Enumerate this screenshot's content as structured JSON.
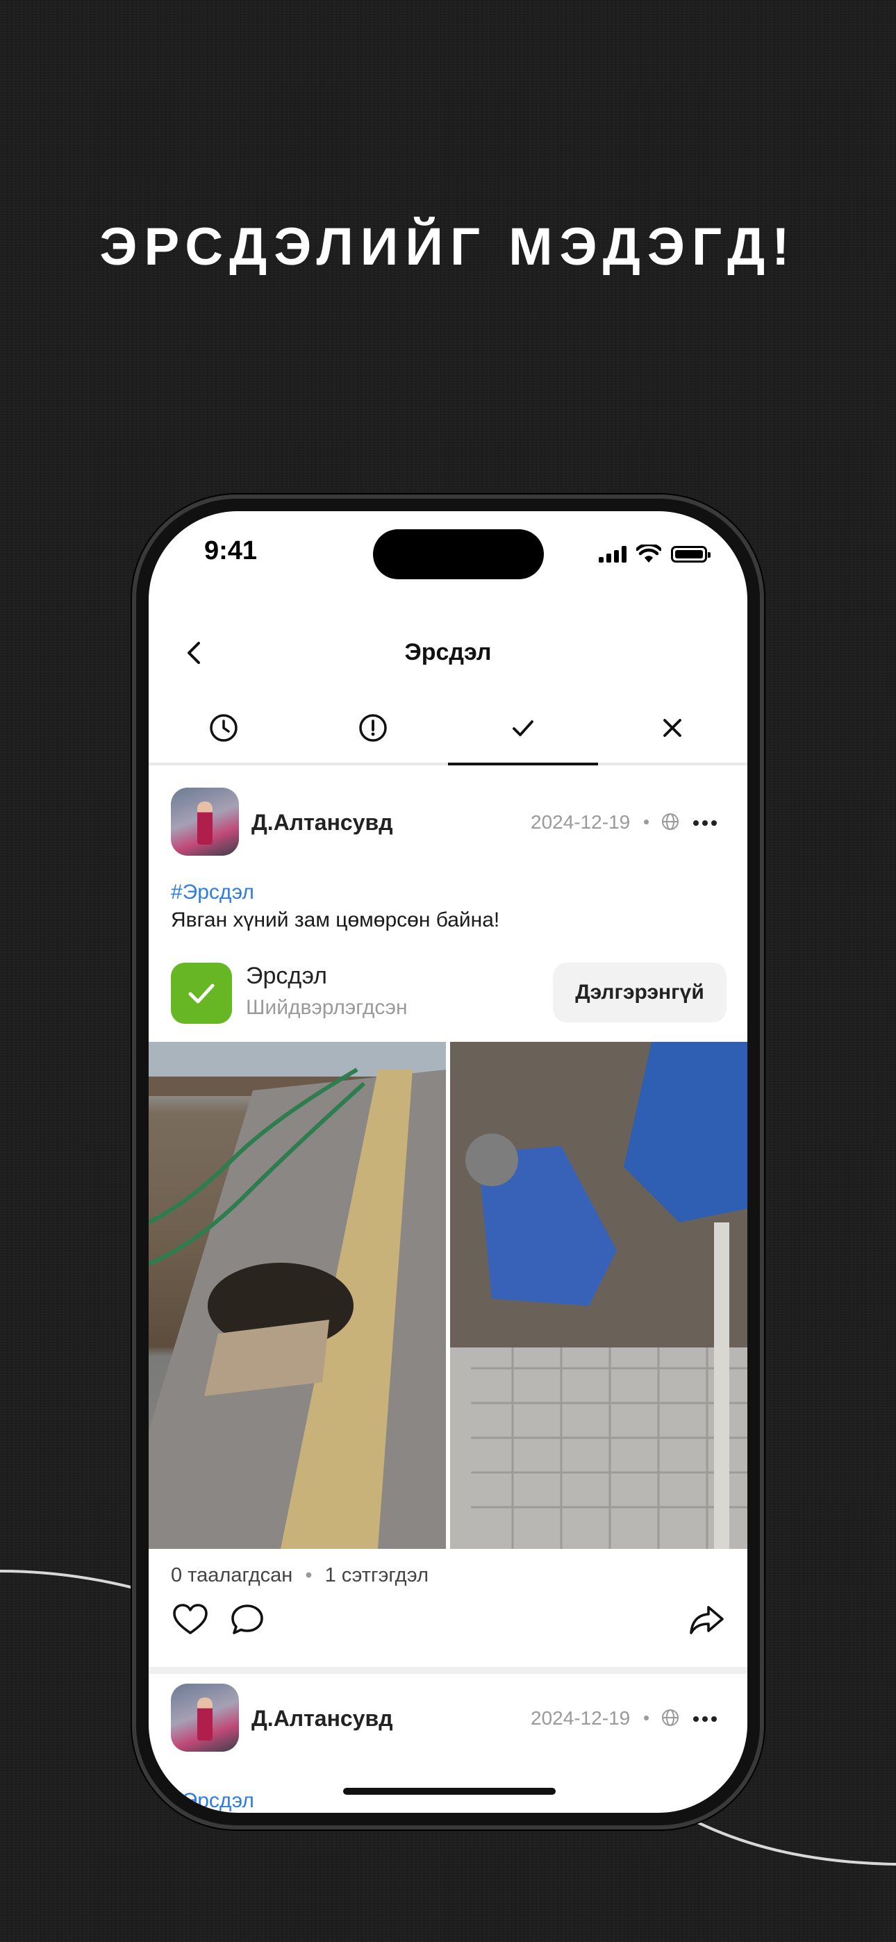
{
  "headline": "ЭРСДЭЛИЙГ МЭДЭГД!",
  "status_bar": {
    "time": "9:41"
  },
  "nav": {
    "title": "Эрсдэл"
  },
  "tabs": [
    {
      "icon": "clock-icon",
      "active": false
    },
    {
      "icon": "alert-circle-icon",
      "active": false
    },
    {
      "icon": "check-icon",
      "active": true
    },
    {
      "icon": "close-icon",
      "active": false
    }
  ],
  "posts": [
    {
      "user": "Д.Алтансувд",
      "date": "2024-12-19",
      "dot": "•",
      "hashtag": "#Эрсдэл",
      "text": "Явган хүний зам цөмөрсөн байна!",
      "status": {
        "title": "Эрсдэл",
        "subtitle": "Шийдвэрлэгдсэн",
        "button": "Дэлгэрэнгүй",
        "color": "#67b623"
      },
      "likes": "0 таалагдсан",
      "separator": "•",
      "comments": "1 сэтгэгдэл"
    },
    {
      "user": "Д.Алтансувд",
      "date": "2024-12-19",
      "dot": "•",
      "hashtag": "#Эрсдэл"
    }
  ],
  "colors": {
    "accent": "#2f7de1",
    "resolved": "#67b623",
    "background": "#1c1c1c"
  }
}
